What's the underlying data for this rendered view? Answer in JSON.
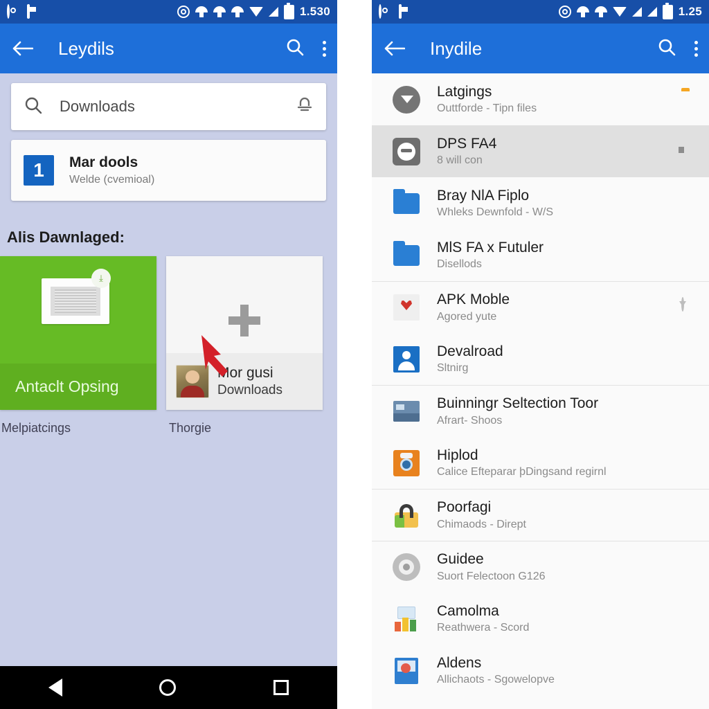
{
  "left": {
    "status": {
      "time": "1.530",
      "icons": [
        "message-icon",
        "screenshot-icon",
        "globe-icon",
        "cast-icon",
        "wifi-alt-icon",
        "wifi-alt2-icon",
        "wifi-icon",
        "signal-icon",
        "battery-icon"
      ]
    },
    "appbar": {
      "title": "Leydils",
      "back": "back-arrow",
      "search": "search-icon",
      "overflow": "more-options"
    },
    "search": {
      "value": "Downloads",
      "placeholder": "Downloads",
      "trailing_icon": "bell-icon"
    },
    "file_item": {
      "badge": "1",
      "title": "Mar dools",
      "subtitle": "Welde (cvemioal)"
    },
    "section_title": "Alis Dawnlaged:",
    "cards": [
      {
        "label": "Antaclt Opsing",
        "caption": "Melpiatcings",
        "type": "green-preview"
      },
      {
        "title": "Mor gusi",
        "subtitle": "Downloads",
        "caption": "Thorgie",
        "type": "add-card",
        "plus": "+"
      }
    ],
    "navbar": {
      "back": "nav-back",
      "home": "nav-home",
      "recents": "nav-recents"
    }
  },
  "right": {
    "status": {
      "time": "1.25",
      "icons": [
        "message-icon",
        "screenshot-icon",
        "globe-icon",
        "cast-icon",
        "wifi-alt-icon",
        "wifi-icon",
        "signal-icon",
        "signal2-icon",
        "battery-icon"
      ]
    },
    "appbar": {
      "title": "Inydile",
      "back": "back-arrow",
      "search": "search-icon",
      "overflow": "more-options"
    },
    "rows": [
      {
        "title": "Latgings",
        "subtitle": "Outtforde - Tipn files",
        "icon": "send-icon",
        "accessory": "folder-orange",
        "selected": false,
        "divider": false
      },
      {
        "title": "DPS FA4",
        "subtitle": "8 will con",
        "icon": "face-icon",
        "accessory": "dark-tag",
        "selected": true,
        "divider": false
      },
      {
        "title": "Bray NlA Fiplo",
        "subtitle": "Whleks Dewnfold - W/S",
        "icon": "folder-icon",
        "accessory": "box",
        "selected": false,
        "divider": false
      },
      {
        "title": "MlS FA x Futuler",
        "subtitle": "Disellods",
        "icon": "folder-icon",
        "accessory": "box",
        "selected": false,
        "divider": false
      },
      {
        "title": "APK Moble",
        "subtitle": "Agored yute",
        "icon": "apk-icon",
        "accessory": "circle-arrow",
        "selected": false,
        "divider": true
      },
      {
        "title": "Devalroad",
        "subtitle": "Sltnirg",
        "icon": "person-icon",
        "accessory": "box",
        "selected": false,
        "divider": false
      },
      {
        "title": "Buinningr Seltection Toor",
        "subtitle": "Afrart- Shoos",
        "icon": "photo-icon",
        "accessory": "box",
        "selected": false,
        "divider": true
      },
      {
        "title": "Hiplod",
        "subtitle": "Calice Efteparar þDingsand regirnl",
        "icon": "camera-icon",
        "accessory": "box",
        "selected": false,
        "divider": false
      },
      {
        "title": "Poorfagi",
        "subtitle": "Chimaods - Dirept",
        "icon": "lock-icon",
        "accessory": "box",
        "selected": false,
        "divider": true
      },
      {
        "title": "Guidee",
        "subtitle": "Suort Felectoon G126",
        "icon": "gear-icon",
        "accessory": "box",
        "selected": false,
        "divider": true
      },
      {
        "title": "Camolma",
        "subtitle": "Reathwera - Scord",
        "icon": "chart-icon",
        "accessory": "box",
        "selected": false,
        "divider": false
      },
      {
        "title": "Aldens",
        "subtitle": "Allichaots - Sgowelopve",
        "icon": "doc-icon",
        "accessory": "box",
        "selected": false,
        "divider": false
      }
    ]
  },
  "colors": {
    "appbar": "#1E6FD9",
    "statusbar": "#174FA8",
    "background": "#C9CFE8",
    "accent_green": "#66BB25",
    "arrow_red": "#D32029"
  }
}
